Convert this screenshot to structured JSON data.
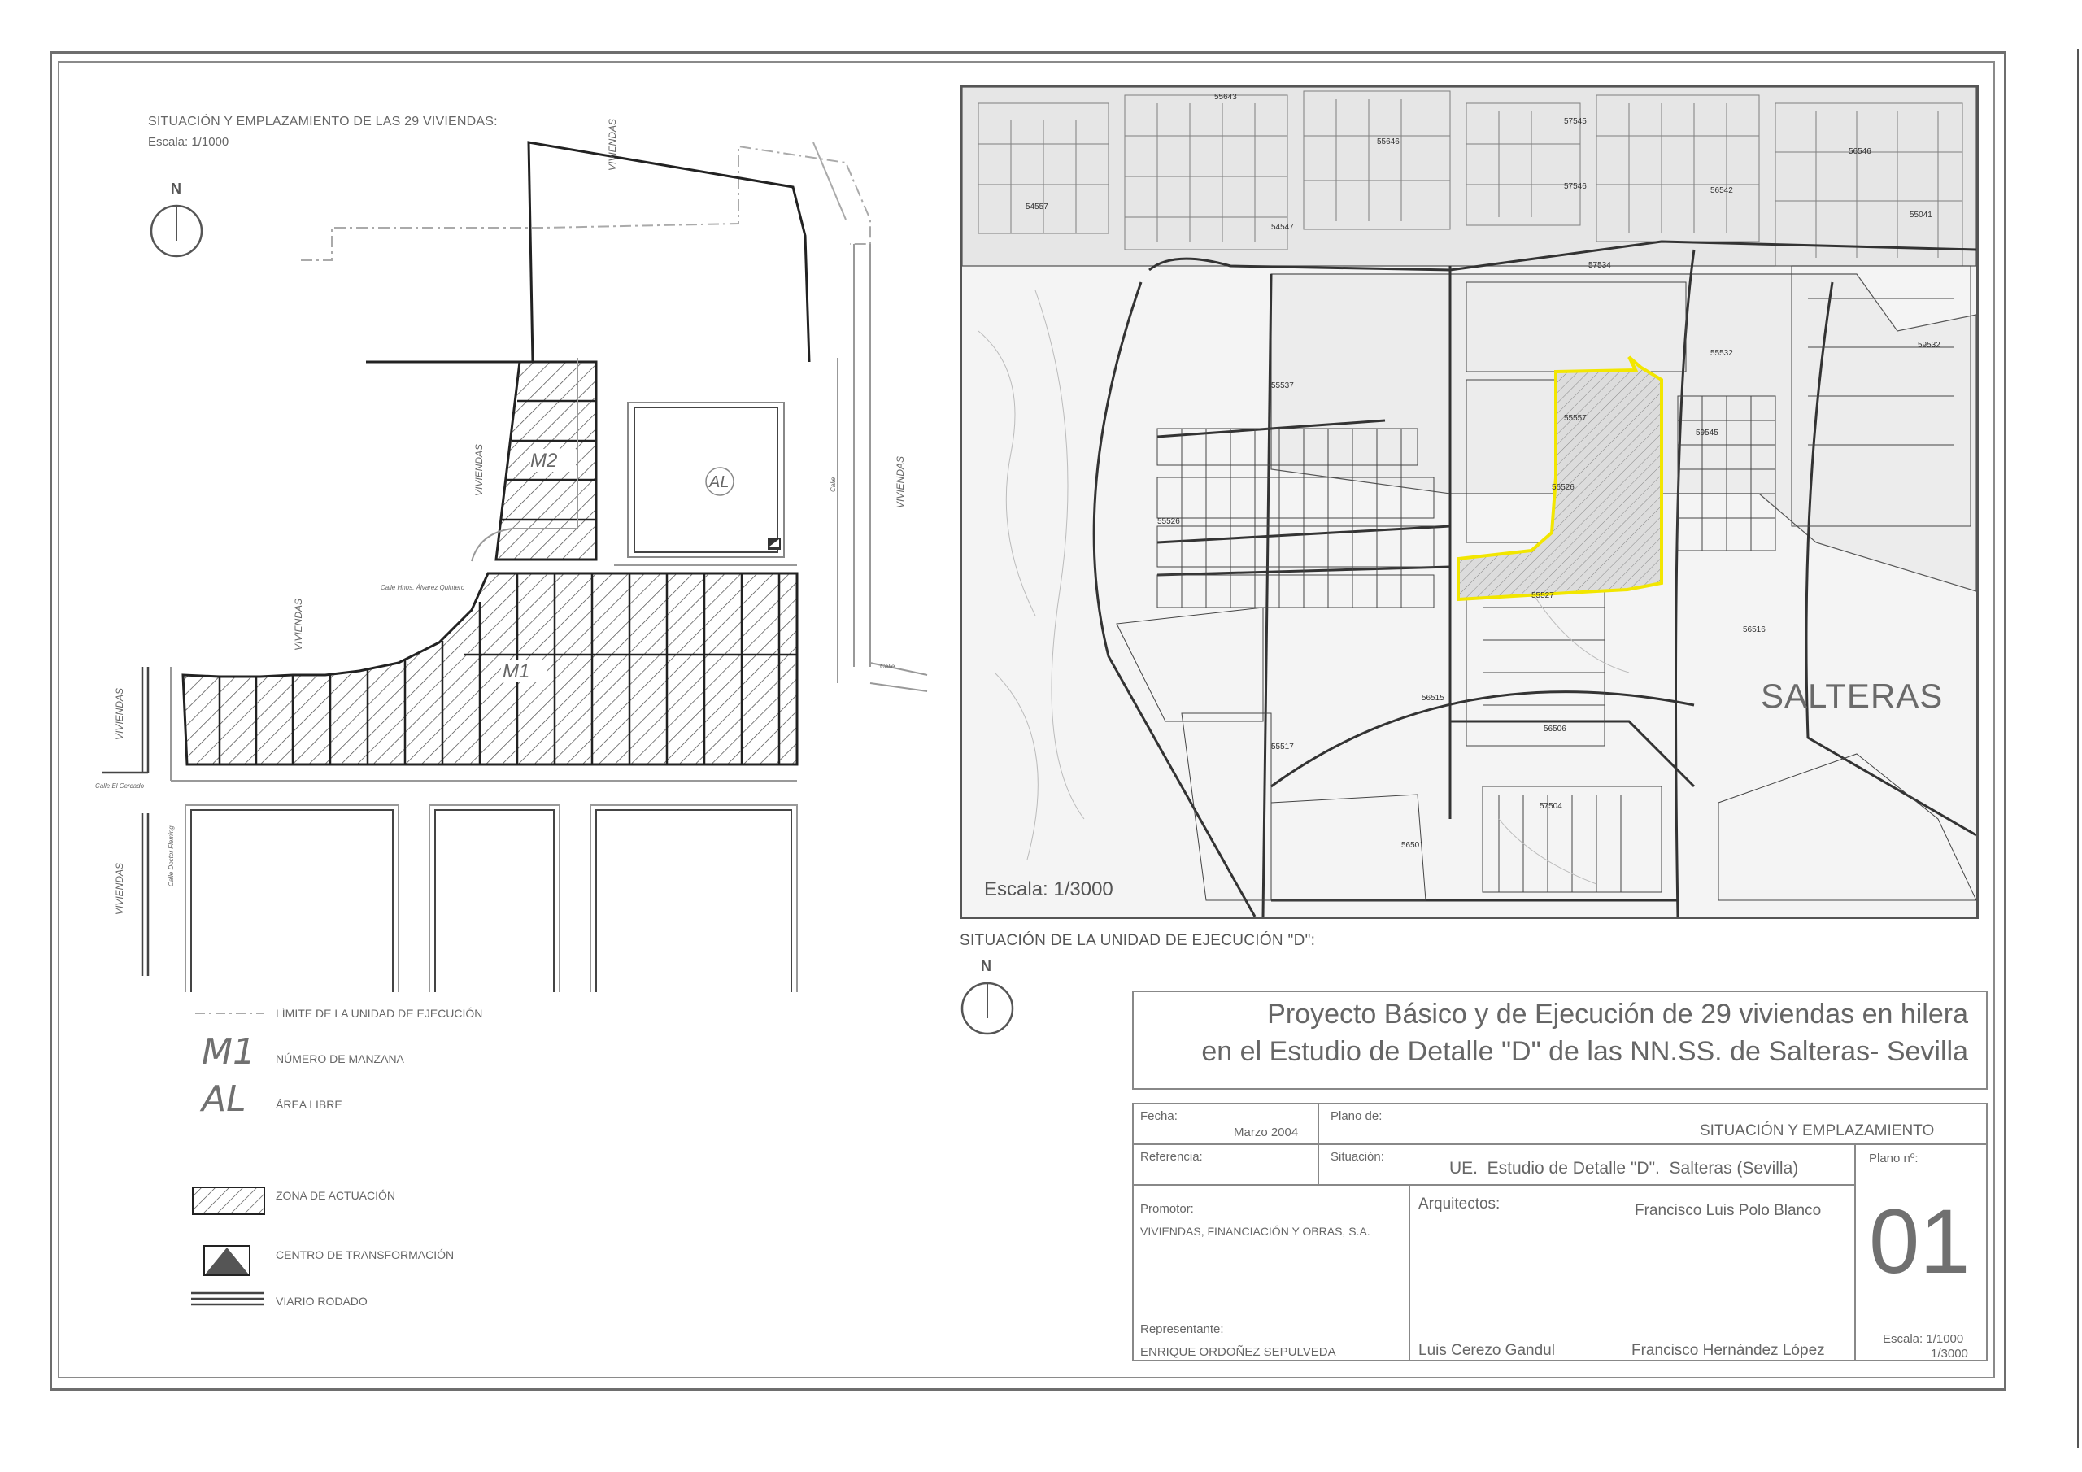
{
  "site_plan": {
    "title": "SITUACIÓN Y EMPLAZAMIENTO DE LAS 29 VIVIENDAS:",
    "scale": "Escala: 1/1000",
    "north": "N",
    "labels": {
      "viviendas": "VIVIENDAS",
      "m1": "M1",
      "m2": "M2",
      "al": "AL",
      "street_alvarez": "Calle Hnos. Álvarez Quintero",
      "street_calle": "Calle",
      "street_cercado": "Calle El Cercado",
      "street_fleming": "Calle Doctor Fleming"
    }
  },
  "location_map": {
    "title": "SITUACIÓN DE LA UNIDAD DE EJECUCIÓN \"D\":",
    "scale": "Escala: 1/3000",
    "town": "SALTERAS",
    "north": "N",
    "highlight_color": "#f2e600"
  },
  "legend": {
    "items": [
      {
        "symbol": "",
        "label": "LÍMITE DE LA UNIDAD DE EJECUCIÓN"
      },
      {
        "symbol": "M1",
        "label": "NÚMERO DE MANZANA"
      },
      {
        "symbol": "AL",
        "label": "ÁREA LIBRE"
      },
      {
        "symbol": "",
        "label": "ZONA DE ACTUACIÓN"
      },
      {
        "symbol": "",
        "label": "CENTRO DE TRANSFORMACIÓN"
      },
      {
        "symbol": "",
        "label": "VIARIO RODADO"
      }
    ]
  },
  "title_block": {
    "project_line1": "Proyecto Básico y de Ejecución de 29 viviendas en hilera",
    "project_line2": "en el Estudio de Detalle \"D\" de las NN.SS. de Salteras- Sevilla",
    "fecha_label": "Fecha:",
    "fecha_value": "Marzo 2004",
    "plano_de_label": "Plano de:",
    "plano_de_value": "SITUACIÓN Y EMPLAZAMIENTO",
    "referencia_label": "Referencia:",
    "situacion_label": "Situación:",
    "situacion_value": "UE.  Estudio de Detalle \"D\".  Salteras (Sevilla)",
    "plano_no_label": "Plano nº:",
    "plano_no_value": "01",
    "promotor_label": "Promotor:",
    "promotor_value": "VIVIENDAS, FINANCIACIÓN Y OBRAS, S.A.",
    "arquitectos_label": "Arquitectos:",
    "arquitecto_1": "Francisco Luis Polo Blanco",
    "arquitecto_2": "Luis Cerezo Gandul",
    "arquitecto_3": "Francisco Hernández López",
    "representante_label": "Representante:",
    "representante_value": "ENRIQUE ORDOÑEZ SEPULVEDA",
    "escala_label": "Escala: 1/1000",
    "escala_value2": "1/3000"
  }
}
